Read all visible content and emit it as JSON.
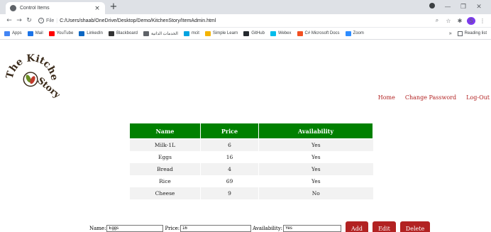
{
  "browser": {
    "tab_title": "Control Items",
    "tab_close": "×",
    "new_tab": "+",
    "url_scheme": "File",
    "url_sep": "|",
    "url": "C:/Users/shaab/OneDrive/Desktop/Demo/KitchenStory/ItemAdmin.html",
    "avatar_letter": "S",
    "bookmarks": [
      {
        "label": "Apps",
        "color": "#4285f4"
      },
      {
        "label": "Mail",
        "color": "#1a73e8"
      },
      {
        "label": "YouTube",
        "color": "#ff0000"
      },
      {
        "label": "LinkedIn",
        "color": "#0a66c2"
      },
      {
        "label": "Blackboard",
        "color": "#333333"
      },
      {
        "label": "الخدمات الذاتية",
        "color": "#5f6368"
      },
      {
        "label": "mcit",
        "color": "#00a3e0"
      },
      {
        "label": "Simple Learn",
        "color": "#f4b400"
      },
      {
        "label": "GitHub",
        "color": "#24292e"
      },
      {
        "label": "Webex",
        "color": "#00bceb"
      },
      {
        "label": "C# Microsoft Docs",
        "color": "#f25022"
      },
      {
        "label": "Zoom",
        "color": "#2d8cff"
      }
    ],
    "reading_list": "Reading list",
    "more_bookmarks": "»"
  },
  "logo": {
    "text": "The Kitchen Story"
  },
  "nav": {
    "home": "Home",
    "change_password": "Change Password",
    "logout": "Log-Out"
  },
  "table": {
    "headers": [
      "Name",
      "Price",
      "Availability"
    ],
    "rows": [
      [
        "Milk-1L",
        "6",
        "Yes"
      ],
      [
        "Eggs",
        "16",
        "Yes"
      ],
      [
        "Bread",
        "4",
        "Yes"
      ],
      [
        "Rice",
        "69",
        "Yes"
      ],
      [
        "Cheese",
        "9",
        "No"
      ]
    ]
  },
  "form": {
    "name_label": "Name:",
    "name_value": "Eggs",
    "price_label": "Price:",
    "price_value": "16",
    "availability_label": "Availability:",
    "availability_value": "Yes",
    "add_label": "Add",
    "edit_label": "Edit",
    "delete_label": "Delete"
  },
  "colors": {
    "header_green": "#008000",
    "button_red": "#b22222",
    "link_red": "#b22222"
  }
}
